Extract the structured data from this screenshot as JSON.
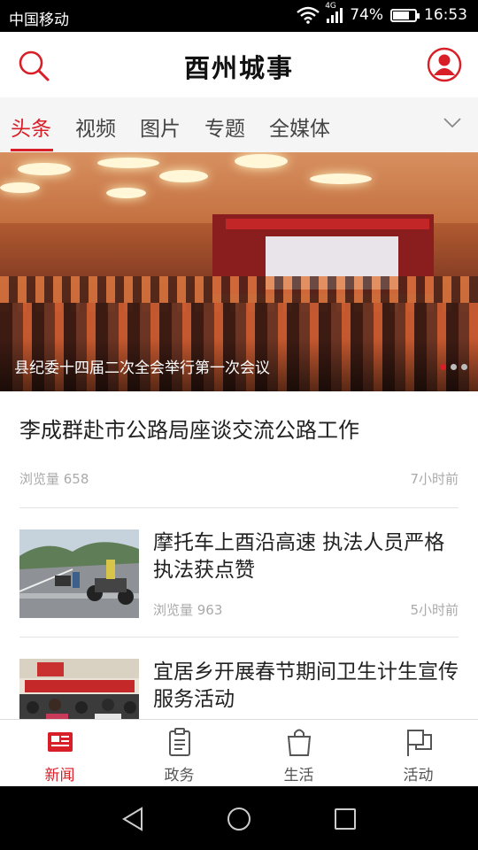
{
  "status_bar": {
    "carrier": "中国移动",
    "network": "4G",
    "battery": "74%",
    "battery_level": 0.74,
    "time": "16:53"
  },
  "header": {
    "title": "酉州城事",
    "search_icon": "search-icon",
    "user_icon": "user-icon"
  },
  "tabs": [
    {
      "label": "头条",
      "active": true
    },
    {
      "label": "视频",
      "active": false
    },
    {
      "label": "图片",
      "active": false
    },
    {
      "label": "专题",
      "active": false
    },
    {
      "label": "全媒体",
      "active": false
    }
  ],
  "banner": {
    "caption": "县纪委十四届二次全会举行第一次会议",
    "slide_count": 3,
    "active_slide": 1
  },
  "articles": [
    {
      "title": "李成群赴市公路局座谈交流公路工作",
      "views": "浏览量 658",
      "time": "7小时前"
    },
    {
      "title": "摩托车上酉沿高速 执法人员严格执法获点赞",
      "views": "浏览量 963",
      "time": "5小时前"
    },
    {
      "title": "宜居乡开展春节期间卫生计生宣传服务活动"
    }
  ],
  "bottom_nav": [
    {
      "label": "新闻",
      "icon": "newspaper-icon",
      "active": true
    },
    {
      "label": "政务",
      "icon": "clipboard-icon",
      "active": false
    },
    {
      "label": "生活",
      "icon": "shopping-bag-icon",
      "active": false
    },
    {
      "label": "活动",
      "icon": "flag-icon",
      "active": false
    }
  ],
  "colors": {
    "accent": "#d81e26",
    "muted": "#aaaaaa"
  }
}
